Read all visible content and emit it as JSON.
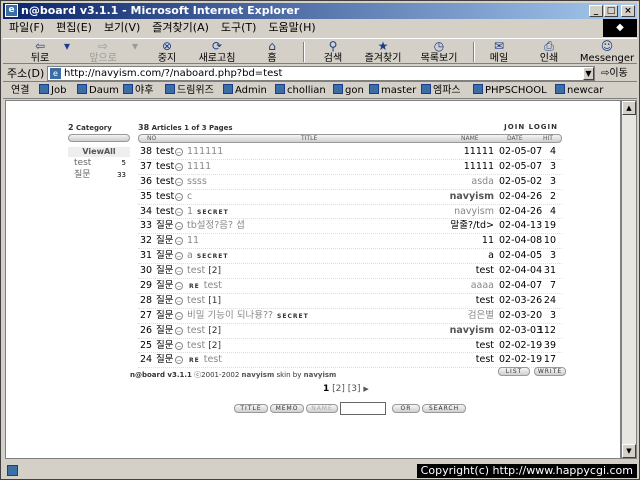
{
  "window": {
    "title": "n@board v3.1.1 - Microsoft Internet Explorer"
  },
  "menu": [
    "파일(F)",
    "편집(E)",
    "보기(V)",
    "즐겨찾기(A)",
    "도구(T)",
    "도움말(H)"
  ],
  "toolbar": {
    "back": "뒤로",
    "forward": "앞으로",
    "stop": "중지",
    "refresh": "새로고침",
    "home": "홈",
    "search": "검색",
    "favorites": "즐겨찾기",
    "history": "목록보기",
    "mail": "메일",
    "print": "인쇄",
    "messenger": "Messenger"
  },
  "address": {
    "label": "주소(D)",
    "url": "http://navyism.com/?/naboard.php?bd=test",
    "go": "이동"
  },
  "links": {
    "label": "연결",
    "items": [
      "Job",
      "Daum",
      "야후",
      "드림위즈",
      "Admin",
      "chollian",
      "gon",
      "master",
      "엠파스",
      "PHPSCHOOL",
      "newcar"
    ]
  },
  "category": {
    "count": "2",
    "label": "Category",
    "viewall": "ViewAll",
    "items": [
      {
        "name": "test",
        "count": "5"
      },
      {
        "name": "질문",
        "count": "33"
      }
    ]
  },
  "board": {
    "total": "38",
    "articles_label": "Articles 1 of 3 Pages",
    "join": "JOIN",
    "login": "LOGIN",
    "cols": {
      "no": "NO",
      "title": "TITLE",
      "name": "NAME",
      "date": "DATE",
      "hit": "HIT"
    },
    "rows": [
      {
        "no": "38",
        "cat": "test",
        "title": "111111",
        "name": "11111",
        "date": "02-05-07",
        "hit": "4"
      },
      {
        "no": "37",
        "cat": "test",
        "title": "1111",
        "name": "11111",
        "date": "02-05-07",
        "hit": "3"
      },
      {
        "no": "36",
        "cat": "test",
        "title": "ssss",
        "name": "asda",
        "date": "02-05-02",
        "hit": "3"
      },
      {
        "no": "35",
        "cat": "test",
        "title": "c",
        "name": "navyism",
        "date": "02-04-26",
        "hit": "2"
      },
      {
        "no": "34",
        "cat": "test",
        "title": "1",
        "flag": "SECRET",
        "name": "navyism",
        "date": "02-04-26",
        "hit": "4"
      },
      {
        "no": "33",
        "cat": "질문",
        "title": "tb설정?음? 셥",
        "name": "말줄?/td>",
        "date": "02-04-13",
        "hit": "19"
      },
      {
        "no": "32",
        "cat": "질문",
        "title": "11",
        "name": "11",
        "date": "02-04-08",
        "hit": "10"
      },
      {
        "no": "31",
        "cat": "질문",
        "title": "a",
        "flag": "SECRET",
        "name": "a",
        "date": "02-04-05",
        "hit": "3"
      },
      {
        "no": "30",
        "cat": "질문",
        "title": "test",
        "tag": "[2]",
        "name": "test",
        "date": "02-04-04",
        "hit": "31"
      },
      {
        "no": "29",
        "cat": "질문",
        "re": "RE",
        "title": "test",
        "name": "aaaa",
        "date": "02-04-07",
        "hit": "7"
      },
      {
        "no": "28",
        "cat": "질문",
        "title": "test",
        "tag": "[1]",
        "name": "test",
        "date": "02-03-26",
        "hit": "24"
      },
      {
        "no": "27",
        "cat": "질문",
        "title": "비밀 기능이 되나용??",
        "flag": "SECRET",
        "name": "검은별",
        "date": "02-03-20",
        "hit": "3"
      },
      {
        "no": "26",
        "cat": "질문",
        "title": "test",
        "tag": "[2]",
        "name": "navyism",
        "date": "02-03-03",
        "hit": "112"
      },
      {
        "no": "25",
        "cat": "질문",
        "title": "test",
        "tag": "[2]",
        "name": "test",
        "date": "02-02-19",
        "hit": "39"
      },
      {
        "no": "24",
        "cat": "질문",
        "re": "RE",
        "title": "test",
        "name": "test",
        "date": "02-02-19",
        "hit": "17"
      }
    ]
  },
  "footer": {
    "brand": "n@board v3.1.1",
    "copy": "ⓒ2001-2002",
    "skin": "navyism",
    "skin_by": "skin by",
    "author": "navyism",
    "list": "LIST",
    "write": "WRITE"
  },
  "pager": {
    "current": "1",
    "p2": "[2]",
    "p3": "[3]",
    "next": "▶"
  },
  "search": {
    "title": "TITLE",
    "memo": "MEMO",
    "name": "NAME",
    "or": "OR",
    "search": "SEARCH"
  },
  "status": {
    "copyright": "Copyright(c) http://www.happycgi.com"
  }
}
